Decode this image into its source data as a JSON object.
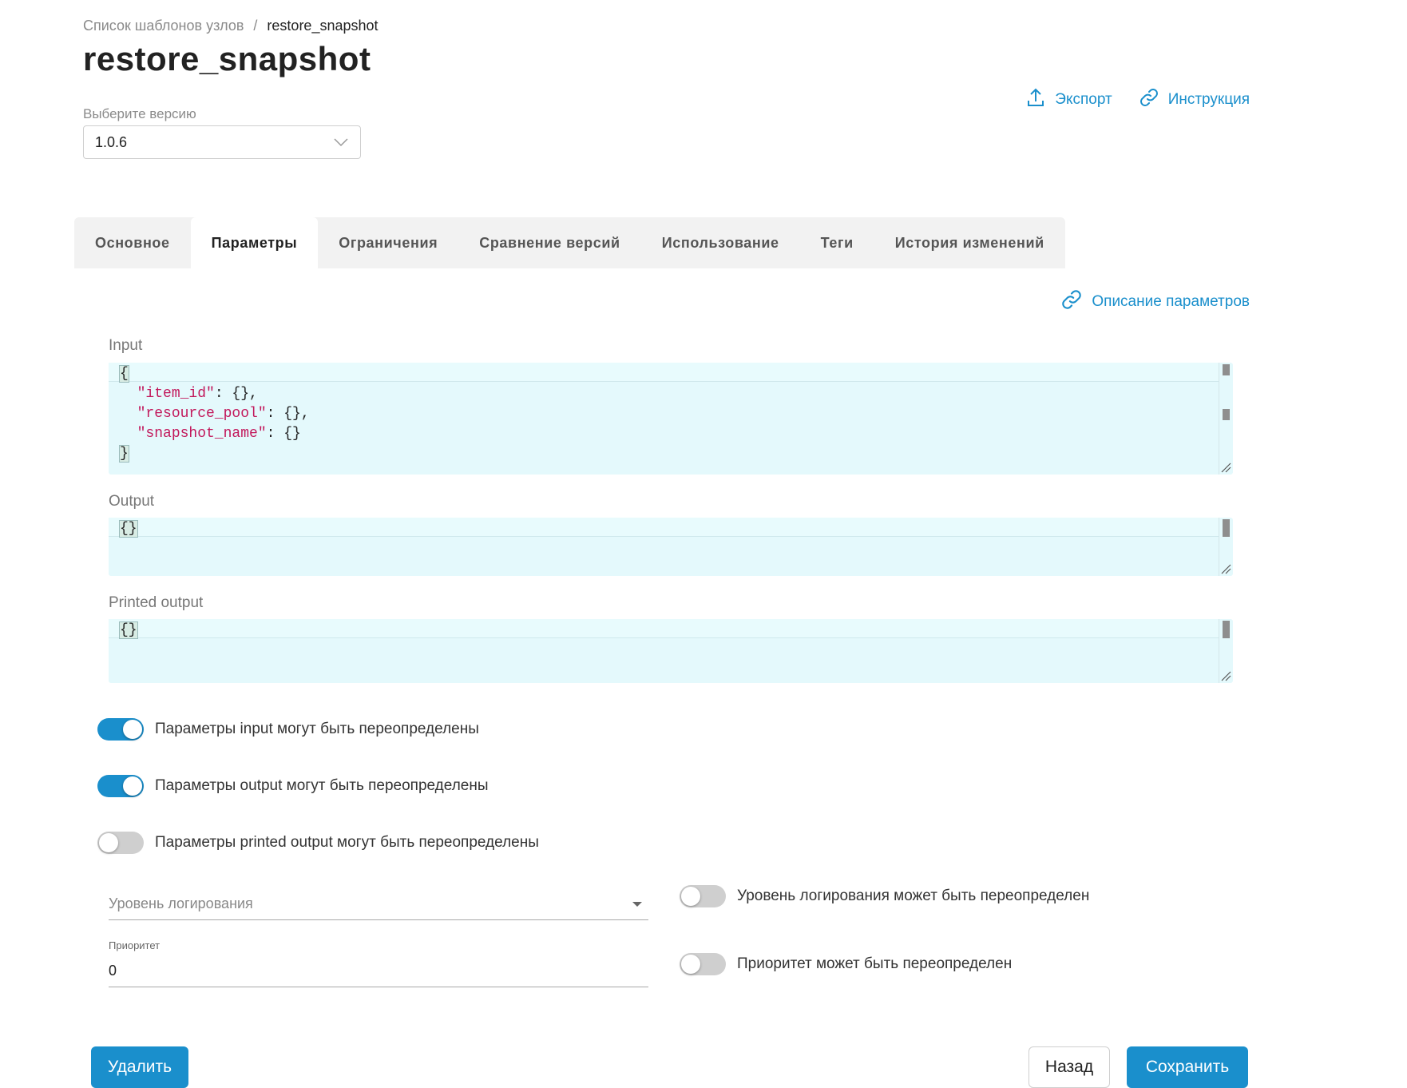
{
  "breadcrumb": {
    "parent": "Список шаблонов узлов",
    "separator": "/",
    "current": "restore_snapshot"
  },
  "page_title": "restore_snapshot",
  "actions": {
    "export": "Экспорт",
    "instruction": "Инструкция"
  },
  "version": {
    "label": "Выберите версию",
    "value": "1.0.6"
  },
  "tabs": [
    {
      "label": "Основное",
      "active": false
    },
    {
      "label": "Параметры",
      "active": true
    },
    {
      "label": "Ограничения",
      "active": false
    },
    {
      "label": "Сравнение версий",
      "active": false
    },
    {
      "label": "Использование",
      "active": false
    },
    {
      "label": "Теги",
      "active": false
    },
    {
      "label": "История изменений",
      "active": false
    }
  ],
  "param_description_link": "Описание параметров",
  "fields": {
    "input": {
      "label": "Input",
      "open_brace": "{",
      "close_brace": "}",
      "lines": [
        {
          "key": "\"item_id\"",
          "rest": ": {},"
        },
        {
          "key": "\"resource_pool\"",
          "rest": ": {},"
        },
        {
          "key": "\"snapshot_name\"",
          "rest": ": {}"
        }
      ]
    },
    "output": {
      "label": "Output",
      "value": "{}"
    },
    "printed_output": {
      "label": "Printed output",
      "value": "{}"
    }
  },
  "toggles": [
    {
      "label": "Параметры input могут быть переопределены",
      "on": true
    },
    {
      "label": "Параметры output могут быть переопределены",
      "on": true
    },
    {
      "label": "Параметры printed output могут быть переопределены",
      "on": false
    }
  ],
  "logging": {
    "placeholder": "Уровень логирования",
    "toggle_label": "Уровень логирования может быть переопределен",
    "toggle_on": false
  },
  "priority": {
    "label": "Приоритет",
    "value": "0",
    "toggle_label": "Приоритет может быть переопределен",
    "toggle_on": false
  },
  "buttons": {
    "delete": "Удалить",
    "back": "Назад",
    "save": "Сохранить"
  },
  "colors": {
    "accent": "#1a8fcc",
    "editor_bg": "#e4f9fc",
    "json_key": "#c2185b"
  },
  "icons": {
    "export": "upload-icon",
    "instruction": "link-icon",
    "param_description": "link-icon"
  }
}
